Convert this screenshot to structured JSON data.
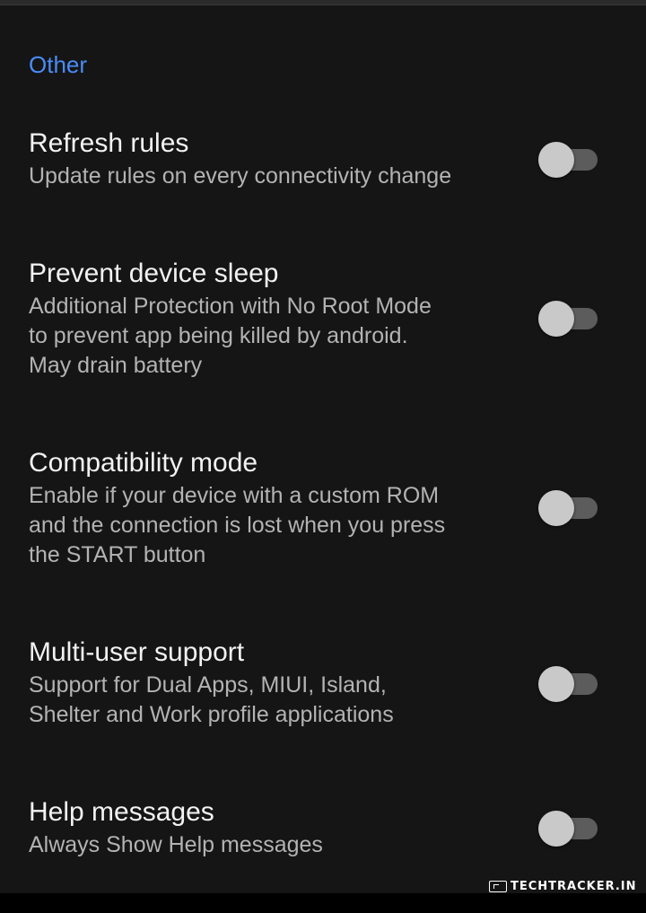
{
  "section": {
    "header": "Other"
  },
  "preferences": [
    {
      "title": "Refresh rules",
      "summary": "Update rules on every connectivity change",
      "enabled": false
    },
    {
      "title": "Prevent device sleep",
      "summary": "Additional Protection with No Root Mode\nto prevent app being killed by android.\nMay drain battery",
      "enabled": false
    },
    {
      "title": "Compatibility mode",
      "summary": "Enable if your device with a custom ROM\nand the connection is lost when you press\nthe START button",
      "enabled": false
    },
    {
      "title": "Multi-user support",
      "summary": "Support for Dual Apps, MIUI, Island,\nShelter and Work profile applications",
      "enabled": false
    },
    {
      "title": "Help messages",
      "summary": "Always Show Help messages",
      "enabled": false
    }
  ],
  "watermark": {
    "text": "TechTracker.in"
  },
  "colors": {
    "background": "#151515",
    "accent": "#4a8cf7",
    "title_text": "#f2f2f2",
    "summary_text": "#b3b3b3",
    "switch_thumb_off": "#c9c9c9",
    "switch_track_off": "#5c5c5c"
  }
}
